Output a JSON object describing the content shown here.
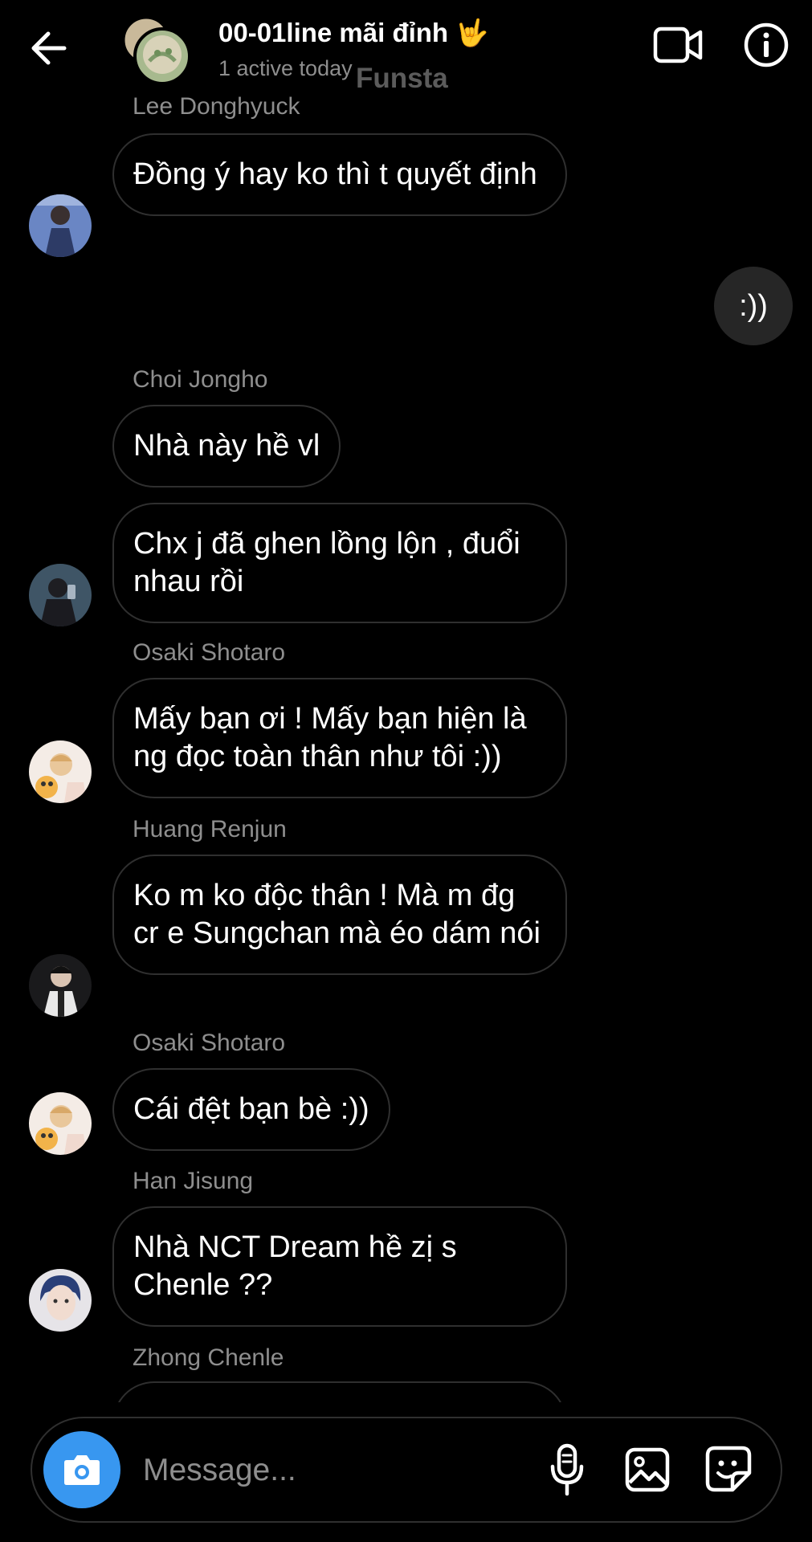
{
  "header": {
    "title": "00-01line mãi đỉnh",
    "title_emoji": "🤟",
    "subtitle": "1 active today",
    "watermark": "Funsta"
  },
  "messages": [
    {
      "sender": "Lee Donghyuck",
      "text": "Đồng ý hay ko thì t quyết định"
    },
    {
      "mine": true,
      "text": ":))"
    },
    {
      "sender": "Choi Jongho",
      "text": "Nhà này hề vl"
    },
    {
      "text": "Chx j đã ghen lồng lộn , đuổi nhau rồi"
    },
    {
      "sender": "Osaki Shotaro",
      "text": "Mấy bạn ơi ! Mấy bạn hiện là ng đọc toàn thân như tôi :))"
    },
    {
      "sender": "Huang Renjun",
      "text": "Ko m ko độc thân ! Mà m đg cr e Sungchan mà éo dám nói"
    },
    {
      "sender": "Osaki Shotaro",
      "text": "Cái đệt bạn bè :))"
    },
    {
      "sender": "Han Jisung",
      "text": "Nhà NCT Dream hề zị s Chenle ??"
    },
    {
      "sender": "Zhong Chenle",
      "text": ""
    }
  ],
  "composer": {
    "placeholder": "Message..."
  },
  "colors": {
    "background": "#000000",
    "bubble_border": "#2f2f2f",
    "my_bubble": "#262626",
    "camera_button": "#3897f0",
    "secondary_text": "#8e8e8e"
  },
  "icons": [
    "back-arrow-icon",
    "video-camera-icon",
    "info-icon",
    "camera-icon",
    "microphone-icon",
    "gallery-icon",
    "sticker-icon"
  ]
}
